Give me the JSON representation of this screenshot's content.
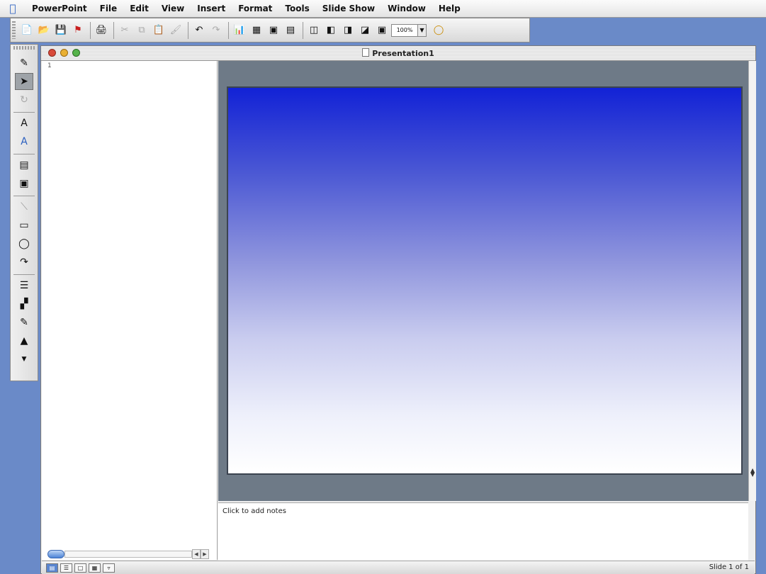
{
  "menubar": {
    "items": [
      "PowerPoint",
      "File",
      "Edit",
      "View",
      "Insert",
      "Format",
      "Tools",
      "Slide Show",
      "Window",
      "Help"
    ]
  },
  "toolbar": {
    "zoom": "100%"
  },
  "window": {
    "title": "Presentation1"
  },
  "outline": {
    "slide_marker": "1"
  },
  "notes": {
    "placeholder": "Click to add notes"
  },
  "status": {
    "slide_position": "Slide 1 of 1"
  },
  "colors": {
    "slide_top": "#1222d6",
    "slide_bottom": "#ffffff",
    "desktop": "#6a8ac8"
  }
}
